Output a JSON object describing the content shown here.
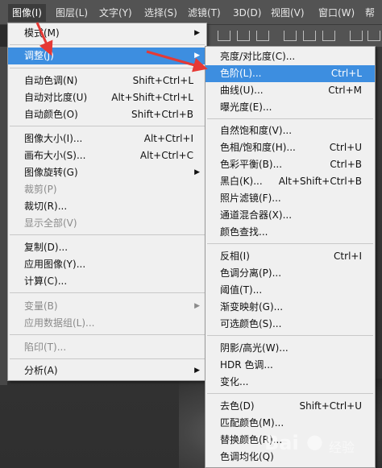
{
  "menubar": {
    "items": [
      {
        "label": "图像(I)",
        "active": true
      },
      {
        "label": "图层(L)"
      },
      {
        "label": "文字(Y)"
      },
      {
        "label": "选择(S)"
      },
      {
        "label": "滤镜(T)"
      },
      {
        "label": "3D(D)"
      },
      {
        "label": "视图(V)"
      },
      {
        "label": "窗口(W)"
      },
      {
        "label": "帮"
      }
    ]
  },
  "image_menu": {
    "items": [
      {
        "label": "模式(M)",
        "submenu": true
      },
      {
        "label": "调整(J)",
        "submenu": true,
        "highlighted": true
      },
      {
        "label": "自动色调(N)",
        "shortcut": "Shift+Ctrl+L"
      },
      {
        "label": "自动对比度(U)",
        "shortcut": "Alt+Shift+Ctrl+L"
      },
      {
        "label": "自动颜色(O)",
        "shortcut": "Shift+Ctrl+B"
      },
      {
        "label": "图像大小(I)...",
        "shortcut": "Alt+Ctrl+I"
      },
      {
        "label": "画布大小(S)...",
        "shortcut": "Alt+Ctrl+C"
      },
      {
        "label": "图像旋转(G)",
        "submenu": true
      },
      {
        "label": "裁剪(P)",
        "disabled": true
      },
      {
        "label": "裁切(R)..."
      },
      {
        "label": "显示全部(V)",
        "disabled": true
      },
      {
        "label": "复制(D)..."
      },
      {
        "label": "应用图像(Y)..."
      },
      {
        "label": "计算(C)..."
      },
      {
        "label": "变量(B)",
        "submenu": true,
        "disabled": true
      },
      {
        "label": "应用数据组(L)...",
        "disabled": true
      },
      {
        "label": "陷印(T)...",
        "disabled": true
      },
      {
        "label": "分析(A)",
        "submenu": true
      }
    ]
  },
  "adjust_submenu": {
    "items": [
      {
        "label": "亮度/对比度(C)..."
      },
      {
        "label": "色阶(L)...",
        "shortcut": "Ctrl+L",
        "highlighted": true
      },
      {
        "label": "曲线(U)...",
        "shortcut": "Ctrl+M"
      },
      {
        "label": "曝光度(E)..."
      },
      {
        "label": "自然饱和度(V)..."
      },
      {
        "label": "色相/饱和度(H)...",
        "shortcut": "Ctrl+U"
      },
      {
        "label": "色彩平衡(B)...",
        "shortcut": "Ctrl+B"
      },
      {
        "label": "黑白(K)...",
        "shortcut": "Alt+Shift+Ctrl+B"
      },
      {
        "label": "照片滤镜(F)..."
      },
      {
        "label": "通道混合器(X)..."
      },
      {
        "label": "颜色查找..."
      },
      {
        "label": "反相(I)",
        "shortcut": "Ctrl+I"
      },
      {
        "label": "色调分离(P)..."
      },
      {
        "label": "阈值(T)..."
      },
      {
        "label": "渐变映射(G)..."
      },
      {
        "label": "可选颜色(S)..."
      },
      {
        "label": "阴影/高光(W)..."
      },
      {
        "label": "HDR 色调..."
      },
      {
        "label": "变化..."
      },
      {
        "label": "去色(D)",
        "shortcut": "Shift+Ctrl+U"
      },
      {
        "label": "匹配颜色(M)..."
      },
      {
        "label": "替换颜色(R)..."
      },
      {
        "label": "色调均化(Q)"
      }
    ]
  },
  "watermark": {
    "text": "Bai",
    "suffix": "经验"
  },
  "colors": {
    "highlight": "#3d8ee0",
    "annotation_arrow": "#e53935"
  }
}
